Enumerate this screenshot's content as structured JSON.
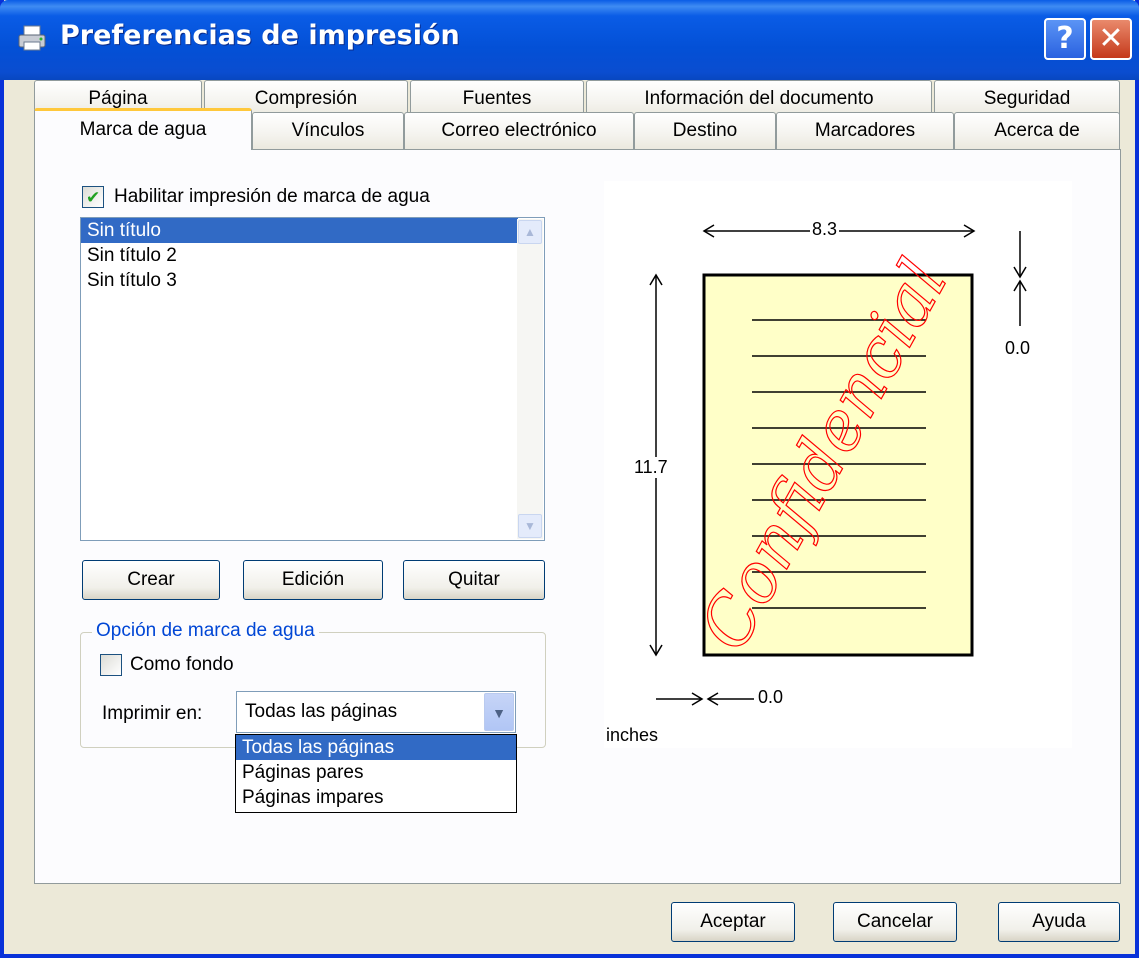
{
  "window": {
    "title": "Preferencias de impresión",
    "help_button": "?",
    "close_button": "✕"
  },
  "tabs": {
    "row_back": [
      "Página",
      "Compresión",
      "Fuentes",
      "Información del documento",
      "Seguridad"
    ],
    "row_front": [
      "Marca de agua",
      "Vínculos",
      "Correo electrónico",
      "Destino",
      "Marcadores",
      "Acerca de"
    ],
    "active": "Marca de agua"
  },
  "watermark": {
    "enable_label": "Habilitar impresión de marca de agua",
    "enable_checked": true,
    "list_items": [
      "Sin título",
      "Sin título 2",
      "Sin título 3"
    ],
    "selected_index": 0
  },
  "buttons": {
    "create": "Crear",
    "edit": "Edición",
    "remove": "Quitar"
  },
  "options": {
    "group_title": "Opción de marca de agua",
    "as_background_label": "Como fondo",
    "as_background_checked": false,
    "print_on_label": "Imprimir en:",
    "print_on_value": "Todas las páginas",
    "print_on_options": [
      "Todas las páginas",
      "Páginas pares",
      "Páginas impares"
    ]
  },
  "preview": {
    "width_value": "8.3",
    "height_value": "11.7",
    "top_offset_value": "0.0",
    "left_offset_value": "0.0",
    "units": "inches",
    "watermark_text": "Confidencial",
    "watermark_color": "#ff0000",
    "page_color": "#ffffc8"
  },
  "footer": {
    "ok": "Aceptar",
    "cancel": "Cancelar",
    "help": "Ayuda"
  }
}
